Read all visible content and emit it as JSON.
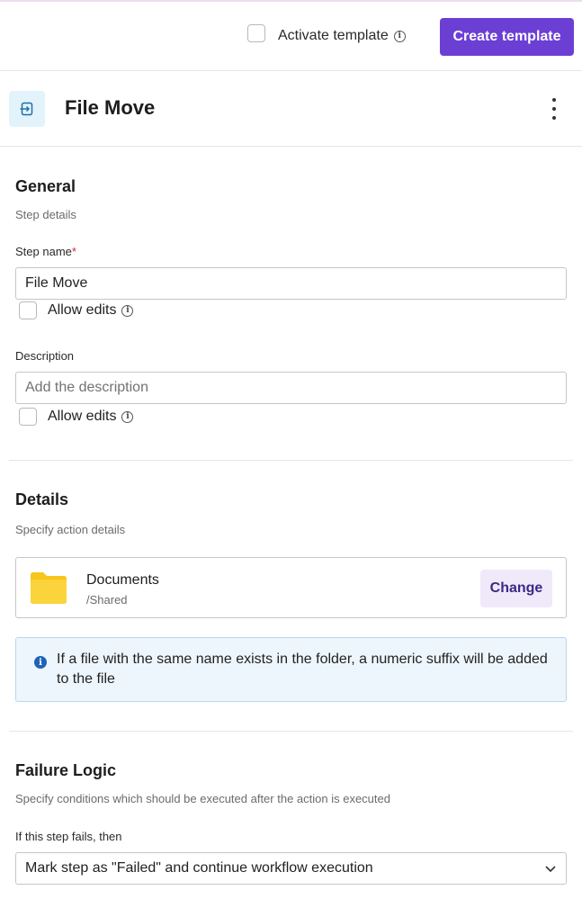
{
  "header": {
    "activate_template_label": "Activate template",
    "create_template_label": "Create template"
  },
  "step": {
    "title": "File Move",
    "icon": "file-move-icon"
  },
  "general": {
    "title": "General",
    "subtitle": "Step details",
    "step_name_label": "Step name",
    "required_marker": "*",
    "step_name_value": "File Move",
    "allow_edits_label": "Allow edits",
    "description_label": "Description",
    "description_placeholder": "Add the description",
    "description_allow_edits_label": "Allow edits"
  },
  "details": {
    "title": "Details",
    "subtitle": "Specify action details",
    "folder_name": "Documents",
    "folder_path": "/Shared",
    "change_label": "Change",
    "info_message": "If a file with the same name exists in the folder, a numeric suffix will be added to the file"
  },
  "failure": {
    "title": "Failure Logic",
    "subtitle": "Specify conditions which should be executed after the action is executed",
    "condition_label": "If this step fails, then",
    "selected_option": "Mark step as \"Failed\" and continue workflow execution"
  },
  "colors": {
    "primary": "#6b3fd4",
    "secondary_bg": "#efe9fa",
    "info_bg": "#eef6fd",
    "folder": "#f8c51c",
    "required": "#d0293b"
  }
}
